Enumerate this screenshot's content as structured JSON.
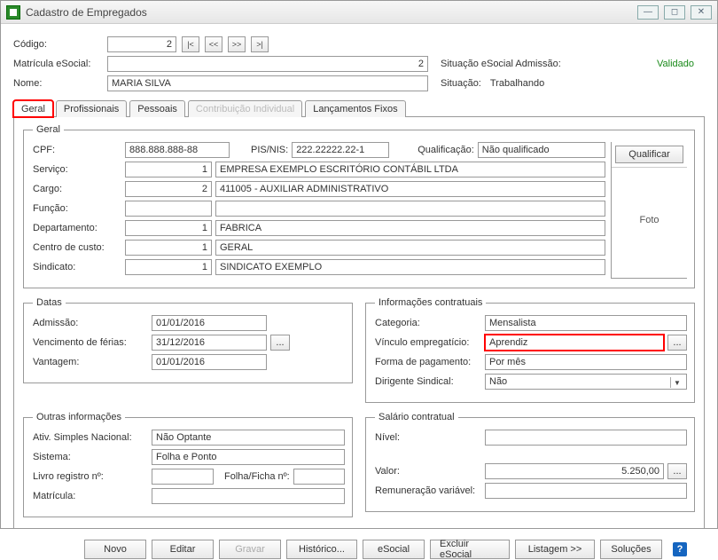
{
  "window": {
    "title": "Cadastro de Empregados"
  },
  "top": {
    "codigo_label": "Código:",
    "codigo_value": "2",
    "nav": {
      "first": "|<",
      "prev": "<<",
      "next": ">>",
      "last": ">|"
    },
    "matricula_label": "Matrícula eSocial:",
    "matricula_value": "2",
    "situacao_esocial_label": "Situação eSocial Admissão:",
    "situacao_esocial_value": "Validado",
    "nome_label": "Nome:",
    "nome_value": "MARIA SILVA",
    "situacao_label": "Situação:",
    "situacao_value": "Trabalhando"
  },
  "tabs": {
    "geral": "Geral",
    "profissionais": "Profissionais",
    "pessoais": "Pessoais",
    "contrib": "Contribuição Individual",
    "lancamentos": "Lançamentos Fixos"
  },
  "geral": {
    "legend": "Geral",
    "cpf_label": "CPF:",
    "cpf_value": "888.888.888-88",
    "pisnis_label": "PIS/NIS:",
    "pisnis_value": "222.22222.22-1",
    "qualif_label": "Qualificação:",
    "qualif_value": "Não qualificado",
    "qualificar_btn": "Qualificar",
    "foto_label": "Foto",
    "servico_label": "Serviço:",
    "servico_code": "1",
    "servico_desc": "EMPRESA EXEMPLO ESCRITÓRIO CONTÁBIL LTDA",
    "cargo_label": "Cargo:",
    "cargo_code": "2",
    "cargo_desc": "411005 - AUXILIAR ADMINISTRATIVO",
    "funcao_label": "Função:",
    "funcao_code": "",
    "funcao_desc": "",
    "depto_label": "Departamento:",
    "depto_code": "1",
    "depto_desc": "FABRICA",
    "centro_label": "Centro de custo:",
    "centro_code": "1",
    "centro_desc": "GERAL",
    "sindicato_label": "Sindicato:",
    "sindicato_code": "1",
    "sindicato_desc": "SINDICATO EXEMPLO"
  },
  "datas": {
    "legend": "Datas",
    "admissao_label": "Admissão:",
    "admissao_value": "01/01/2016",
    "ferias_label": "Vencimento de férias:",
    "ferias_value": "31/12/2016",
    "vantagem_label": "Vantagem:",
    "vantagem_value": "01/01/2016"
  },
  "contratuais": {
    "legend": "Informações contratuais",
    "categoria_label": "Categoria:",
    "categoria_value": "Mensalista",
    "vinculo_label": "Vínculo empregatício:",
    "vinculo_value": "Aprendiz",
    "forma_label": "Forma de pagamento:",
    "forma_value": "Por mês",
    "dirigente_label": "Dirigente Sindical:",
    "dirigente_value": "Não"
  },
  "outras": {
    "legend": "Outras informações",
    "simples_label": "Ativ. Simples Nacional:",
    "simples_value": "Não Optante",
    "sistema_label": "Sistema:",
    "sistema_value": "Folha e Ponto",
    "livro_label": "Livro registro nº:",
    "livro_value": "",
    "folha_label": "Folha/Ficha nº:",
    "folha_value": "",
    "matricula_label": "Matrícula:",
    "matricula_value": ""
  },
  "salario": {
    "legend": "Salário contratual",
    "nivel_label": "Nível:",
    "nivel_value": "",
    "valor_label": "Valor:",
    "valor_value": "5.250,00",
    "remun_label": "Remuneração variável:",
    "remun_value": ""
  },
  "buttons": {
    "novo": "Novo",
    "editar": "Editar",
    "gravar": "Gravar",
    "historico": "Histórico...",
    "esocial": "eSocial",
    "excluir": "Excluir eSocial",
    "listagem": "Listagem >>",
    "solucoes": "Soluções",
    "dots": "..."
  }
}
